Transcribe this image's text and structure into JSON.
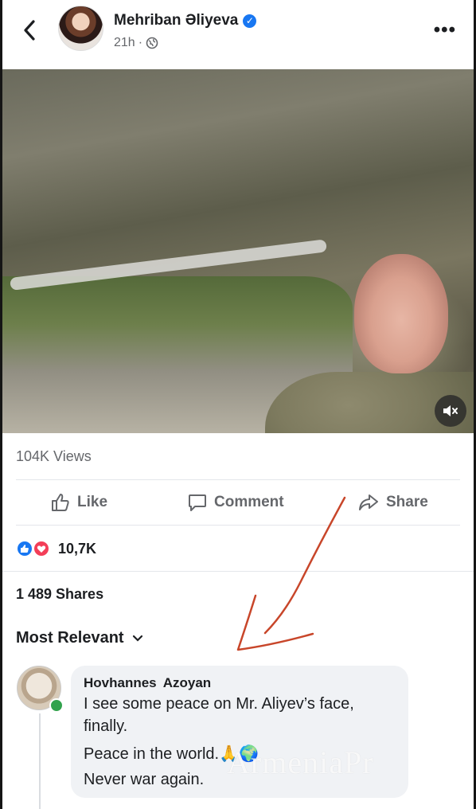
{
  "post": {
    "author": "Mehriban Əliyeva",
    "time": "21h",
    "more": "•••",
    "views": "104K Views"
  },
  "actions": {
    "like": "Like",
    "comment": "Comment",
    "share": "Share"
  },
  "reactions": {
    "count": "10,7K"
  },
  "shares": "1 489 Shares",
  "sort": {
    "label": "Most Relevant"
  },
  "comment": {
    "author": "Hovhannes Azoyan",
    "line1": "I see some peace on Mr. Aliyev’s face,",
    "line2": "finally.",
    "line3": "Peace in the world.🙏🌍",
    "line4": "Never war again."
  },
  "watermark": "ArmeniaPr",
  "colors": {
    "accent": "#1877f2",
    "love": "#f33e58",
    "online": "#31a24c",
    "annotation": "#c8462a"
  },
  "icons": [
    "back-arrow-icon",
    "verified-icon",
    "globe-icon",
    "more-icon",
    "mute-icon",
    "like-icon",
    "comment-icon",
    "share-icon",
    "chevron-down-icon"
  ]
}
